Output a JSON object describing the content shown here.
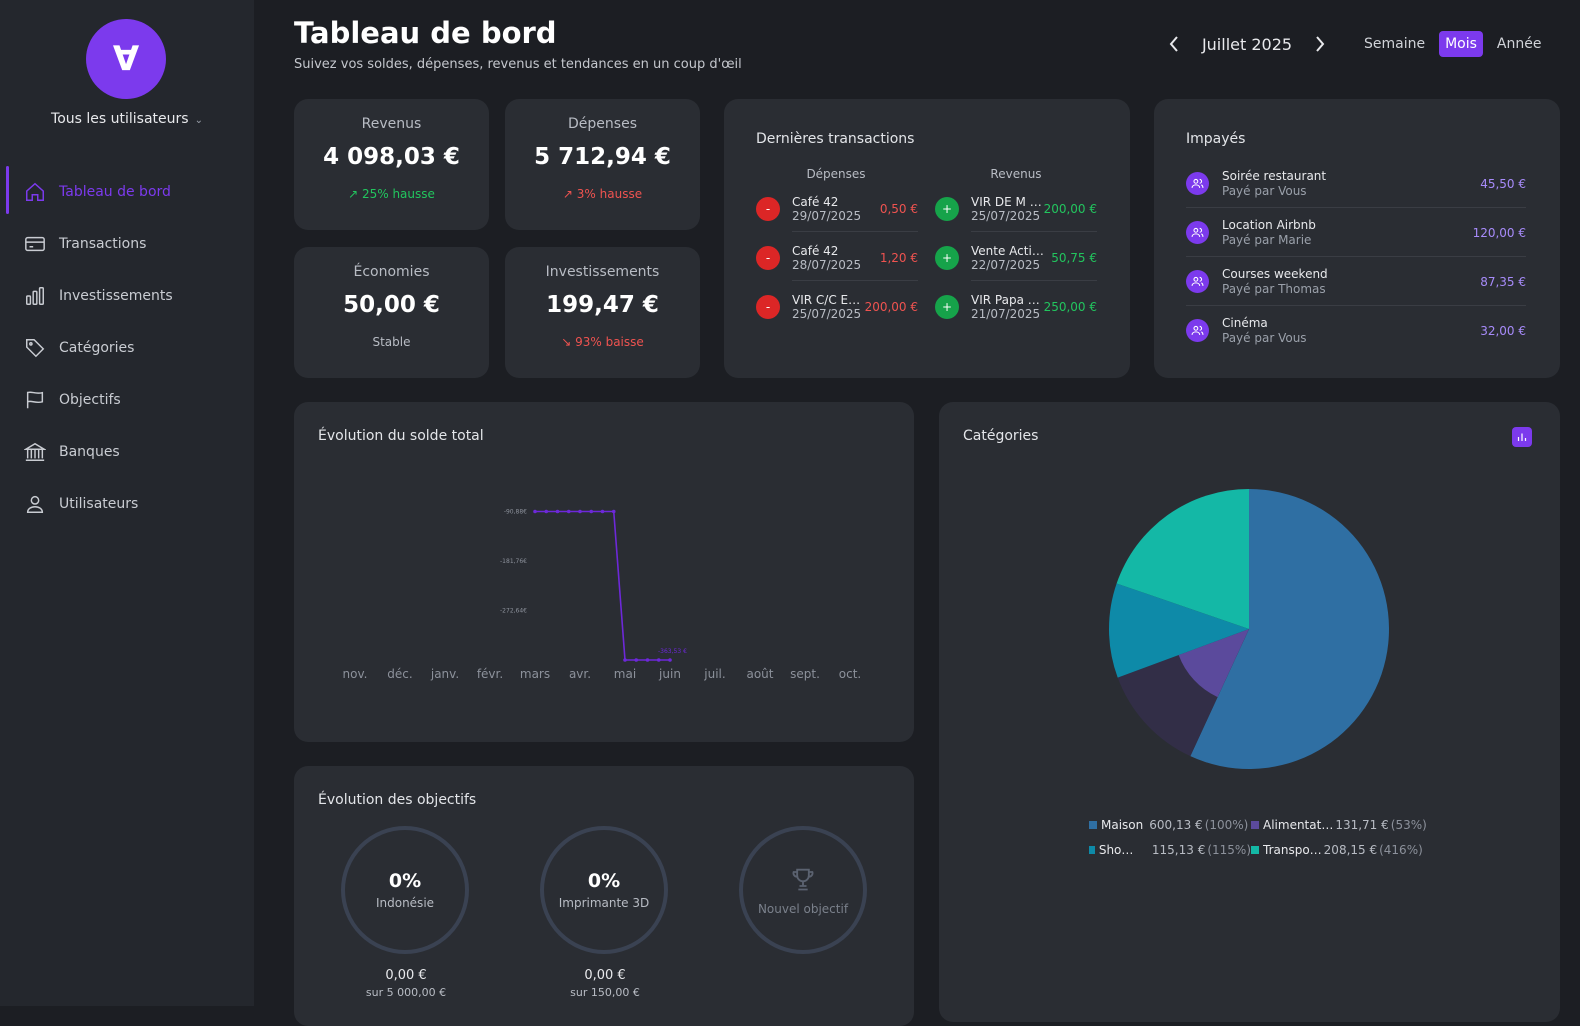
{
  "app": {
    "logo_glyph": "∀",
    "user_selector": "Tous les utilisateurs"
  },
  "sidebar": {
    "items": [
      {
        "label": "Tableau de bord",
        "icon": "home-icon",
        "active": true
      },
      {
        "label": "Transactions",
        "icon": "credit-card-icon"
      },
      {
        "label": "Investissements",
        "icon": "bar-chart-icon"
      },
      {
        "label": "Catégories",
        "icon": "tag-icon"
      },
      {
        "label": "Objectifs",
        "icon": "flag-icon"
      },
      {
        "label": "Banques",
        "icon": "bank-icon"
      },
      {
        "label": "Utilisateurs",
        "icon": "user-icon"
      }
    ]
  },
  "header": {
    "title": "Tableau de bord",
    "subtitle": "Suivez vos soldes, dépenses, revenus et tendances en un coup d'œil",
    "period": "Juillet 2025",
    "modes": [
      "Semaine",
      "Mois",
      "Année"
    ],
    "active_mode": "Mois"
  },
  "stats": {
    "revenus": {
      "label": "Revenus",
      "value": "4 098,03 €",
      "trend": "25% hausse"
    },
    "depenses": {
      "label": "Dépenses",
      "value": "5 712,94 €",
      "trend": "3% hausse"
    },
    "economies": {
      "label": "Économies",
      "value": "50,00 €",
      "trend": "Stable"
    },
    "investissements": {
      "label": "Investissements",
      "value": "199,47 €",
      "trend": "93% baisse"
    }
  },
  "transactions": {
    "title": "Dernières transactions",
    "expenses_header": "Dépenses",
    "income_header": "Revenus",
    "expenses": [
      {
        "name": "Café 42",
        "date": "29/07/2025",
        "amount": "0,50 €"
      },
      {
        "name": "Café 42",
        "date": "28/07/2025",
        "amount": "1,20 €"
      },
      {
        "name": "VIR C/C E…",
        "date": "25/07/2025",
        "amount": "200,00 €"
      }
    ],
    "income": [
      {
        "name": "VIR DE M …",
        "date": "25/07/2025",
        "amount": "200,00 €"
      },
      {
        "name": "Vente Actio…",
        "date": "22/07/2025",
        "amount": "50,75 €"
      },
      {
        "name": "VIR Papa v…",
        "date": "21/07/2025",
        "amount": "250,00 €"
      }
    ]
  },
  "unpaid": {
    "title": "Impayés",
    "items": [
      {
        "name": "Soirée restaurant",
        "payer": "Payé par Vous",
        "amount": "45,50 €"
      },
      {
        "name": "Location Airbnb",
        "payer": "Payé par Marie",
        "amount": "120,00 €"
      },
      {
        "name": "Courses weekend",
        "payer": "Payé par Thomas",
        "amount": "87,35 €"
      },
      {
        "name": "Cinéma",
        "payer": "Payé par Vous",
        "amount": "32,00 €"
      }
    ]
  },
  "balance_chart": {
    "title": "Évolution du solde total"
  },
  "goals": {
    "title": "Évolution des objectifs",
    "items": [
      {
        "pct": "0%",
        "name": "Indonésie",
        "current": "0,00 €",
        "target": "sur 5 000,00 €"
      },
      {
        "pct": "0%",
        "name": "Imprimante 3D",
        "current": "0,00 €",
        "target": "sur 150,00 €"
      }
    ],
    "new_goal": "Nouvel objectif"
  },
  "categories": {
    "title": "Catégories",
    "legend": [
      {
        "name": "Maison",
        "value": "600,13 €",
        "pct": "(100%)",
        "color": "#2f6fa3"
      },
      {
        "name": "Alimentat…",
        "value": "131,71 €",
        "pct": "(53%)",
        "color": "#5b4a9c"
      },
      {
        "name": "Shopping",
        "value": "115,13 €",
        "pct": "(115%)",
        "color": "#0e8aa8"
      },
      {
        "name": "Transpo…",
        "value": "208,15 €",
        "pct": "(416%)",
        "color": "#14b8a6"
      }
    ]
  },
  "chart_data": [
    {
      "type": "line",
      "title": "Évolution du solde total",
      "x_ticks": [
        "nov.",
        "déc.",
        "janv.",
        "févr.",
        "mars",
        "avr.",
        "mai",
        "juin",
        "juil.",
        "août",
        "sept.",
        "oct."
      ],
      "y_ticks": [
        "-90,88€",
        "-181,76€",
        "-272,64€"
      ],
      "series": [
        {
          "color": "#6d28d9",
          "x": [
            0.0,
            0.25,
            0.5,
            0.75,
            1.0,
            1.25,
            1.5,
            1.75,
            2.0,
            2.25,
            2.5,
            2.75,
            3.0
          ],
          "y": [
            -90.88,
            -90.88,
            -90.88,
            -90.88,
            -90.88,
            -90.88,
            -90.88,
            -90.88,
            -363.53,
            -363.53,
            -363.53,
            -363.53,
            -363.53
          ]
        }
      ],
      "end_label": "-363,53 €"
    },
    {
      "type": "pie",
      "title": "Catégories",
      "slices": [
        {
          "label": "Maison",
          "value": 600.13,
          "color": "#2f6fa3"
        },
        {
          "label": "Alimentation",
          "value": 131.71,
          "color": "#5b4a9c"
        },
        {
          "label": "Shopping",
          "value": 115.13,
          "color": "#0e8aa8"
        },
        {
          "label": "Transport",
          "value": 208.15,
          "color": "#14b8a6"
        }
      ]
    }
  ]
}
